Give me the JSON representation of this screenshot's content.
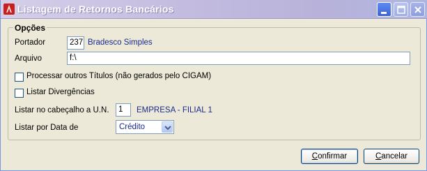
{
  "window": {
    "title": "Listagem de Retornos Bancários",
    "icon": "cigam-app-icon"
  },
  "options": {
    "group_label": "Opções",
    "portador": {
      "label": "Portador",
      "code": "237",
      "description": "Bradesco Simples"
    },
    "arquivo": {
      "label": "Arquivo",
      "value": "f:\\"
    },
    "processar_outros": {
      "label": "Processar outros Títulos (não gerados pelo CIGAM)",
      "checked": false
    },
    "listar_divergencias": {
      "label": "Listar Divergências",
      "checked": false
    },
    "listar_un": {
      "label": "Listar no cabeçalho a U.N.",
      "code": "1",
      "description": "EMPRESA - FILIAL 1"
    },
    "listar_data": {
      "label": "Listar por Data de",
      "selected": "Crédito"
    }
  },
  "buttons": {
    "confirm": {
      "first": "C",
      "rest": "onfirmar"
    },
    "cancel": {
      "first": "C",
      "rest": "ancelar"
    }
  }
}
